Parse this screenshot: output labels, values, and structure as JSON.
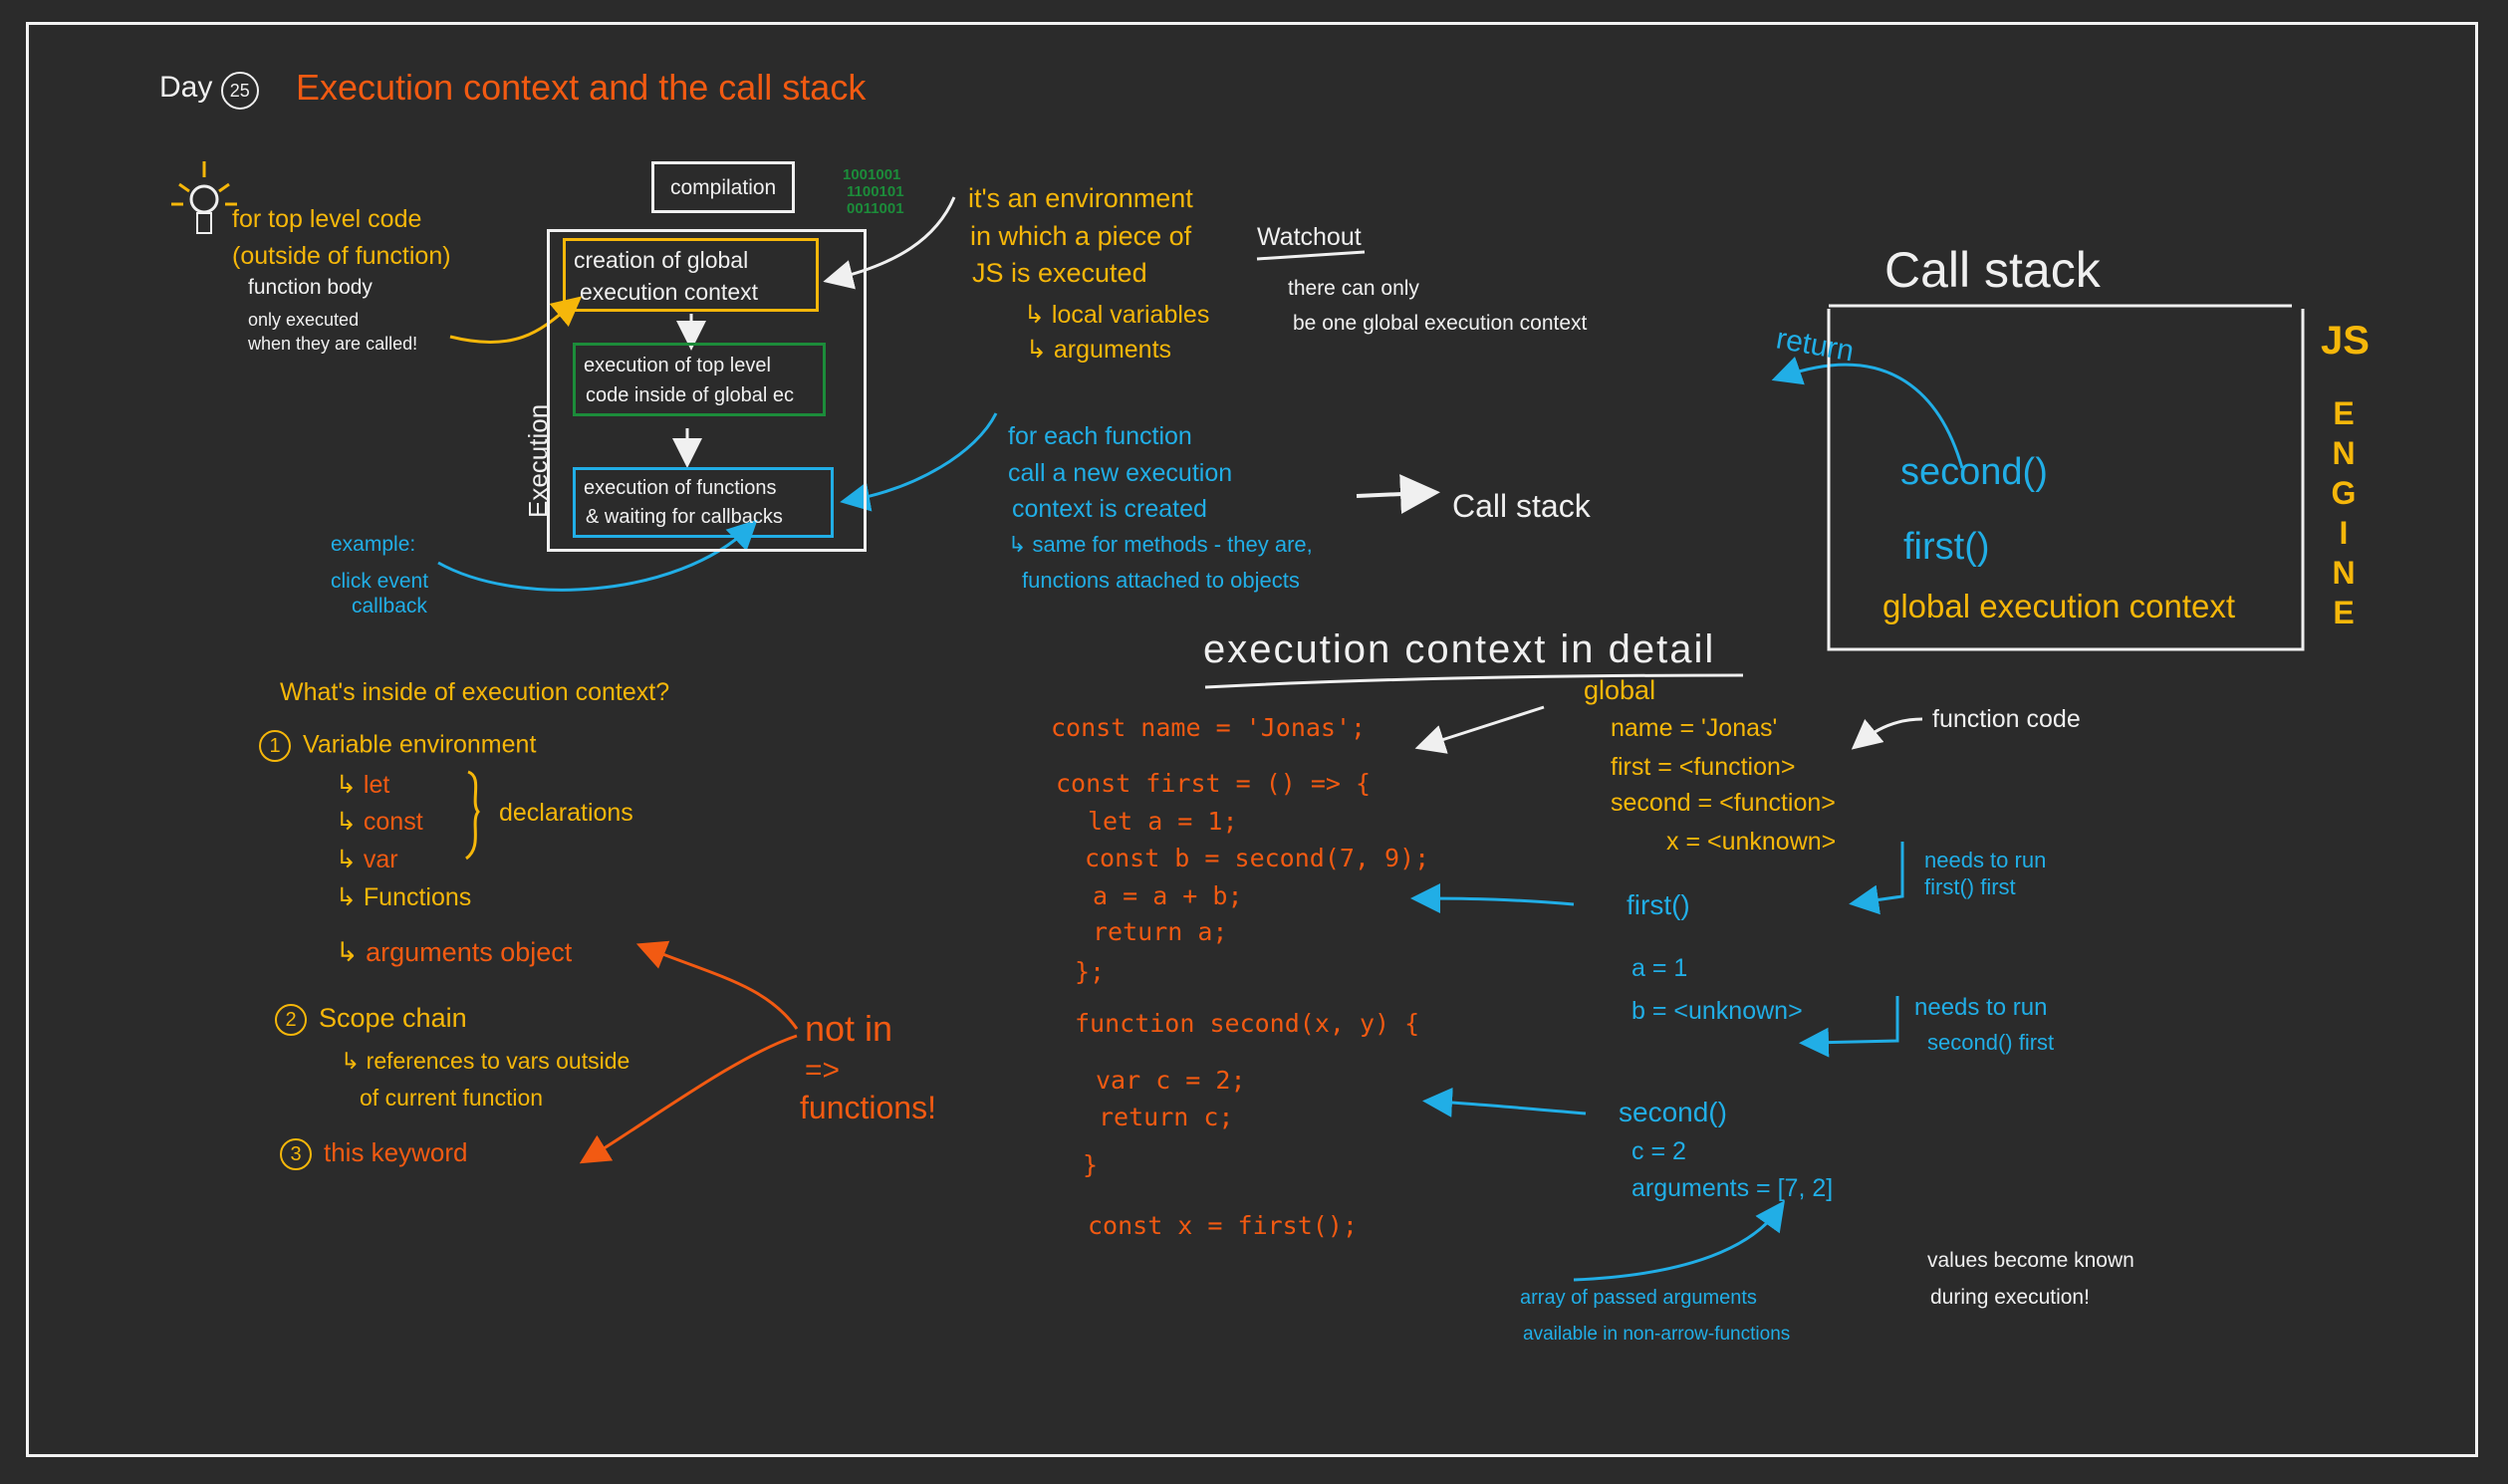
{
  "header": {
    "day_label": "Day",
    "day_number": "25",
    "title": "Execution context and the call stack"
  },
  "tip": {
    "lines": [
      "for top level code",
      "(outside of function)"
    ],
    "sub_lines": [
      "function body",
      "only executed",
      "when they are called!"
    ]
  },
  "flow": {
    "compilation": "compilation",
    "binary": [
      "1001001",
      "1100101",
      "0011001"
    ],
    "execution_label": "Execution",
    "step1": [
      "creation of global",
      "execution context"
    ],
    "step2": [
      "execution of top level",
      "code inside of global ec"
    ],
    "step3": [
      "execution of functions",
      "& waiting for callbacks"
    ],
    "example": [
      "example:",
      "click event",
      "callback"
    ]
  },
  "definition": {
    "lines": [
      "it's an environment",
      "in which a piece of",
      "JS is executed"
    ],
    "items": [
      "local variables",
      "arguments"
    ],
    "watchout": "Watchout",
    "watchout_lines": [
      "there can only",
      "be one global execution context"
    ]
  },
  "function_note": {
    "lines": [
      "for each function",
      "call a new execution",
      "context is created",
      "same for methods - they are,",
      "functions attached to objects"
    ],
    "call_stack_label": "Call stack"
  },
  "call_stack": {
    "title": "Call stack",
    "return_label": "return",
    "frames": [
      "second()",
      "first()",
      "global execution context"
    ],
    "engine_label": [
      "J",
      "S",
      "E",
      "N",
      "G",
      "I",
      "N",
      "E"
    ]
  },
  "contents": {
    "question": "What's inside of execution context?",
    "items": [
      {
        "num": "1",
        "label": "Variable environment"
      },
      {
        "num": "2",
        "label": "Scope chain"
      },
      {
        "num": "3",
        "label": "this keyword"
      }
    ],
    "declarations": [
      "let",
      "const",
      "var"
    ],
    "declarations_label": "declarations",
    "functions": "Functions",
    "arguments_object": "arguments object",
    "scope_sub": [
      "references to vars outside",
      "of current function"
    ],
    "not_in": [
      "not in",
      "=>",
      "functions!"
    ]
  },
  "detail": {
    "title": "execution context in detail",
    "code": [
      "const name = 'Jonas';",
      "const first = () => {",
      "let a = 1;",
      "const b = second(7, 9);",
      "a = a + b;",
      "return a;",
      "};",
      "function second(x, y) {",
      "var c = 2;",
      "return c;",
      "}",
      "const x = first();"
    ],
    "global_label": "global",
    "global_vars": [
      "name = 'Jonas'",
      "first = <function>",
      "second = <function>",
      "x = <unknown>"
    ],
    "function_code_label": "function code",
    "first_ctx": {
      "label": "first()",
      "vars": [
        "a = 1",
        "b = <unknown>"
      ]
    },
    "second_ctx": {
      "label": "second()",
      "vars": [
        "c = 2",
        "arguments = [7, 2]"
      ]
    },
    "note_first": [
      "needs to run",
      "first() first"
    ],
    "note_second": [
      "needs to run",
      "second() first"
    ],
    "arguments_note": [
      "array of passed arguments",
      "available in non-arrow-functions"
    ],
    "values_note": [
      "values become known",
      "during execution!"
    ]
  },
  "colors": {
    "background": "#2b2b2b",
    "orange": "#f25a12",
    "yellow": "#f6b70a",
    "blue": "#21aee6",
    "green": "#1c8c3a",
    "white": "#f0f0f0"
  }
}
